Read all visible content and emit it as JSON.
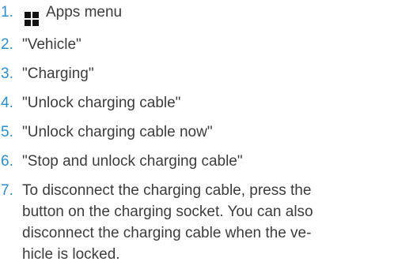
{
  "steps": [
    {
      "number": "1.",
      "icon": "apps-grid-icon",
      "text": "Apps menu"
    },
    {
      "number": "2.",
      "text": "\"Vehicle\""
    },
    {
      "number": "3.",
      "text": "\"Charging\""
    },
    {
      "number": "4.",
      "text": "\"Unlock charging cable\""
    },
    {
      "number": "5.",
      "text": "\"Unlock charging cable now\""
    },
    {
      "number": "6.",
      "text": "\"Stop and unlock charging cable\""
    },
    {
      "number": "7.",
      "lines": [
        "To disconnect the charging cable, press the",
        "button on the charging socket. You can also",
        "disconnect the charging cable when the ve-",
        "hicle is locked."
      ]
    }
  ],
  "colors": {
    "number": "#2c8fd0",
    "text": "#3c3c3c",
    "icon": "#111111"
  }
}
